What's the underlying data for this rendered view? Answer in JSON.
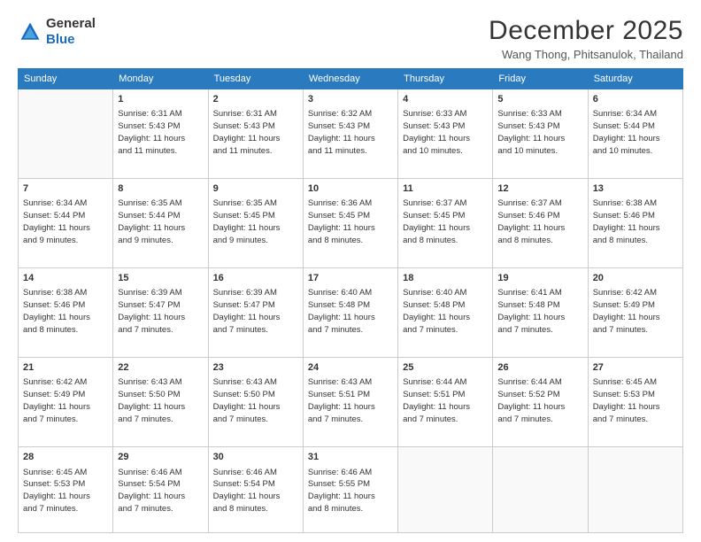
{
  "header": {
    "logo_general": "General",
    "logo_blue": "Blue",
    "month_title": "December 2025",
    "location": "Wang Thong, Phitsanulok, Thailand"
  },
  "days_of_week": [
    "Sunday",
    "Monday",
    "Tuesday",
    "Wednesday",
    "Thursday",
    "Friday",
    "Saturday"
  ],
  "weeks": [
    [
      {
        "day": "",
        "text": ""
      },
      {
        "day": "1",
        "text": "Sunrise: 6:31 AM\nSunset: 5:43 PM\nDaylight: 11 hours\nand 11 minutes."
      },
      {
        "day": "2",
        "text": "Sunrise: 6:31 AM\nSunset: 5:43 PM\nDaylight: 11 hours\nand 11 minutes."
      },
      {
        "day": "3",
        "text": "Sunrise: 6:32 AM\nSunset: 5:43 PM\nDaylight: 11 hours\nand 11 minutes."
      },
      {
        "day": "4",
        "text": "Sunrise: 6:33 AM\nSunset: 5:43 PM\nDaylight: 11 hours\nand 10 minutes."
      },
      {
        "day": "5",
        "text": "Sunrise: 6:33 AM\nSunset: 5:43 PM\nDaylight: 11 hours\nand 10 minutes."
      },
      {
        "day": "6",
        "text": "Sunrise: 6:34 AM\nSunset: 5:44 PM\nDaylight: 11 hours\nand 10 minutes."
      }
    ],
    [
      {
        "day": "7",
        "text": "Sunrise: 6:34 AM\nSunset: 5:44 PM\nDaylight: 11 hours\nand 9 minutes."
      },
      {
        "day": "8",
        "text": "Sunrise: 6:35 AM\nSunset: 5:44 PM\nDaylight: 11 hours\nand 9 minutes."
      },
      {
        "day": "9",
        "text": "Sunrise: 6:35 AM\nSunset: 5:45 PM\nDaylight: 11 hours\nand 9 minutes."
      },
      {
        "day": "10",
        "text": "Sunrise: 6:36 AM\nSunset: 5:45 PM\nDaylight: 11 hours\nand 8 minutes."
      },
      {
        "day": "11",
        "text": "Sunrise: 6:37 AM\nSunset: 5:45 PM\nDaylight: 11 hours\nand 8 minutes."
      },
      {
        "day": "12",
        "text": "Sunrise: 6:37 AM\nSunset: 5:46 PM\nDaylight: 11 hours\nand 8 minutes."
      },
      {
        "day": "13",
        "text": "Sunrise: 6:38 AM\nSunset: 5:46 PM\nDaylight: 11 hours\nand 8 minutes."
      }
    ],
    [
      {
        "day": "14",
        "text": "Sunrise: 6:38 AM\nSunset: 5:46 PM\nDaylight: 11 hours\nand 8 minutes."
      },
      {
        "day": "15",
        "text": "Sunrise: 6:39 AM\nSunset: 5:47 PM\nDaylight: 11 hours\nand 7 minutes."
      },
      {
        "day": "16",
        "text": "Sunrise: 6:39 AM\nSunset: 5:47 PM\nDaylight: 11 hours\nand 7 minutes."
      },
      {
        "day": "17",
        "text": "Sunrise: 6:40 AM\nSunset: 5:48 PM\nDaylight: 11 hours\nand 7 minutes."
      },
      {
        "day": "18",
        "text": "Sunrise: 6:40 AM\nSunset: 5:48 PM\nDaylight: 11 hours\nand 7 minutes."
      },
      {
        "day": "19",
        "text": "Sunrise: 6:41 AM\nSunset: 5:48 PM\nDaylight: 11 hours\nand 7 minutes."
      },
      {
        "day": "20",
        "text": "Sunrise: 6:42 AM\nSunset: 5:49 PM\nDaylight: 11 hours\nand 7 minutes."
      }
    ],
    [
      {
        "day": "21",
        "text": "Sunrise: 6:42 AM\nSunset: 5:49 PM\nDaylight: 11 hours\nand 7 minutes."
      },
      {
        "day": "22",
        "text": "Sunrise: 6:43 AM\nSunset: 5:50 PM\nDaylight: 11 hours\nand 7 minutes."
      },
      {
        "day": "23",
        "text": "Sunrise: 6:43 AM\nSunset: 5:50 PM\nDaylight: 11 hours\nand 7 minutes."
      },
      {
        "day": "24",
        "text": "Sunrise: 6:43 AM\nSunset: 5:51 PM\nDaylight: 11 hours\nand 7 minutes."
      },
      {
        "day": "25",
        "text": "Sunrise: 6:44 AM\nSunset: 5:51 PM\nDaylight: 11 hours\nand 7 minutes."
      },
      {
        "day": "26",
        "text": "Sunrise: 6:44 AM\nSunset: 5:52 PM\nDaylight: 11 hours\nand 7 minutes."
      },
      {
        "day": "27",
        "text": "Sunrise: 6:45 AM\nSunset: 5:53 PM\nDaylight: 11 hours\nand 7 minutes."
      }
    ],
    [
      {
        "day": "28",
        "text": "Sunrise: 6:45 AM\nSunset: 5:53 PM\nDaylight: 11 hours\nand 7 minutes."
      },
      {
        "day": "29",
        "text": "Sunrise: 6:46 AM\nSunset: 5:54 PM\nDaylight: 11 hours\nand 7 minutes."
      },
      {
        "day": "30",
        "text": "Sunrise: 6:46 AM\nSunset: 5:54 PM\nDaylight: 11 hours\nand 8 minutes."
      },
      {
        "day": "31",
        "text": "Sunrise: 6:46 AM\nSunset: 5:55 PM\nDaylight: 11 hours\nand 8 minutes."
      },
      {
        "day": "",
        "text": ""
      },
      {
        "day": "",
        "text": ""
      },
      {
        "day": "",
        "text": ""
      }
    ]
  ]
}
